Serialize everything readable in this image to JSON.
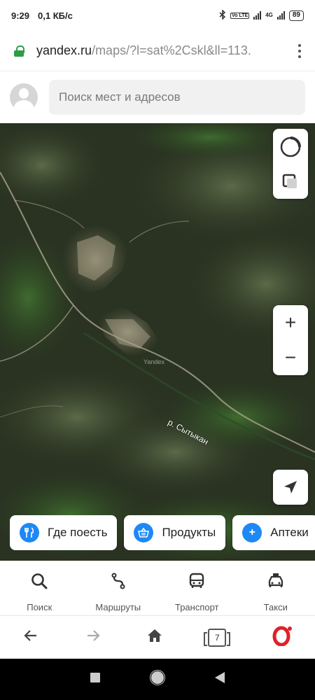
{
  "status_bar": {
    "time": "9:29",
    "speed": "0,1 КБ/с",
    "network": "4G",
    "volte": "Vo LTE",
    "battery": "89"
  },
  "browser": {
    "url_host": "yandex.ru",
    "url_path": "/maps/?l=sat%2Cskl&ll=113.",
    "tab_count": "7"
  },
  "header": {
    "search_placeholder": "Поиск мест и адресов"
  },
  "map": {
    "river_label": "р. Сытыкан",
    "watermark": "Yandex",
    "zoom_in": "+",
    "zoom_out": "−"
  },
  "chips": [
    {
      "label": "Где поесть",
      "icon": "fork-knife-icon"
    },
    {
      "label": "Продукты",
      "icon": "basket-icon"
    },
    {
      "label": "Аптеки",
      "icon": "pharmacy-cross-icon"
    }
  ],
  "bottom_nav": [
    {
      "label": "Поиск",
      "icon": "search-icon"
    },
    {
      "label": "Маршруты",
      "icon": "route-icon"
    },
    {
      "label": "Транспорт",
      "icon": "bus-icon"
    },
    {
      "label": "Такси",
      "icon": "taxi-icon"
    }
  ],
  "colors": {
    "accent_blue": "#1e88f5",
    "lock_green": "#2e9c47",
    "opera_red": "#e0202a"
  }
}
